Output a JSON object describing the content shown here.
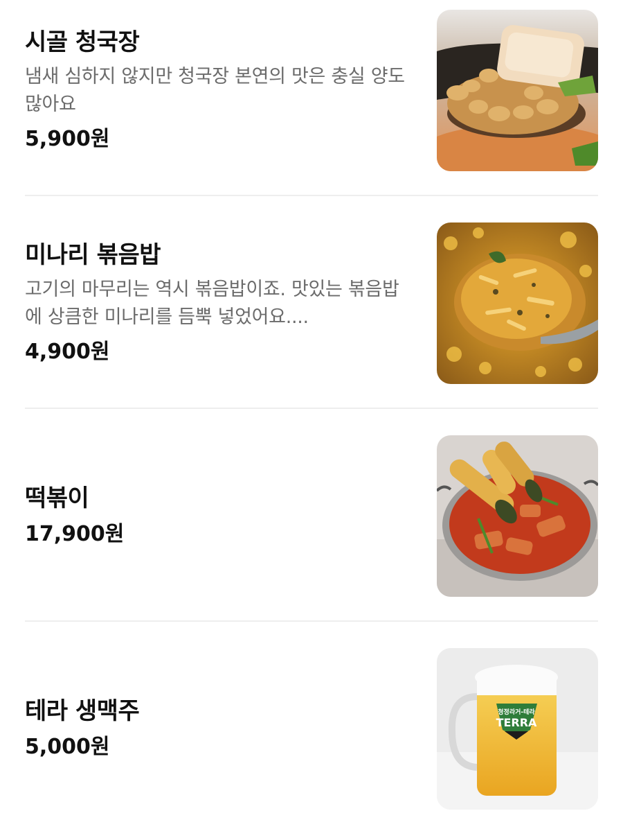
{
  "menu": {
    "items": [
      {
        "name": "시골 청국장",
        "description": "냄새 심하지 않지만 청국장 본연의 맛은 충실 양도 많아요",
        "price": "5,900원",
        "image": "soybean-paste-stew-photo"
      },
      {
        "name": "미나리 볶음밥",
        "description": "고기의 마무리는 역시 볶음밥이죠. 맛있는 볶음밥에 상큼한 미나리를 듬뿍 넣었어요....",
        "price": "4,900원",
        "image": "fried-rice-photo"
      },
      {
        "name": "떡볶이",
        "description": "",
        "price": "17,900원",
        "image": "tteokbokki-photo"
      },
      {
        "name": "테라 생맥주",
        "description": "",
        "price": "5,000원",
        "image": "draft-beer-photo",
        "brand_text": {
          "top": "청정라거-테라",
          "logo": "TERRA"
        }
      }
    ]
  }
}
